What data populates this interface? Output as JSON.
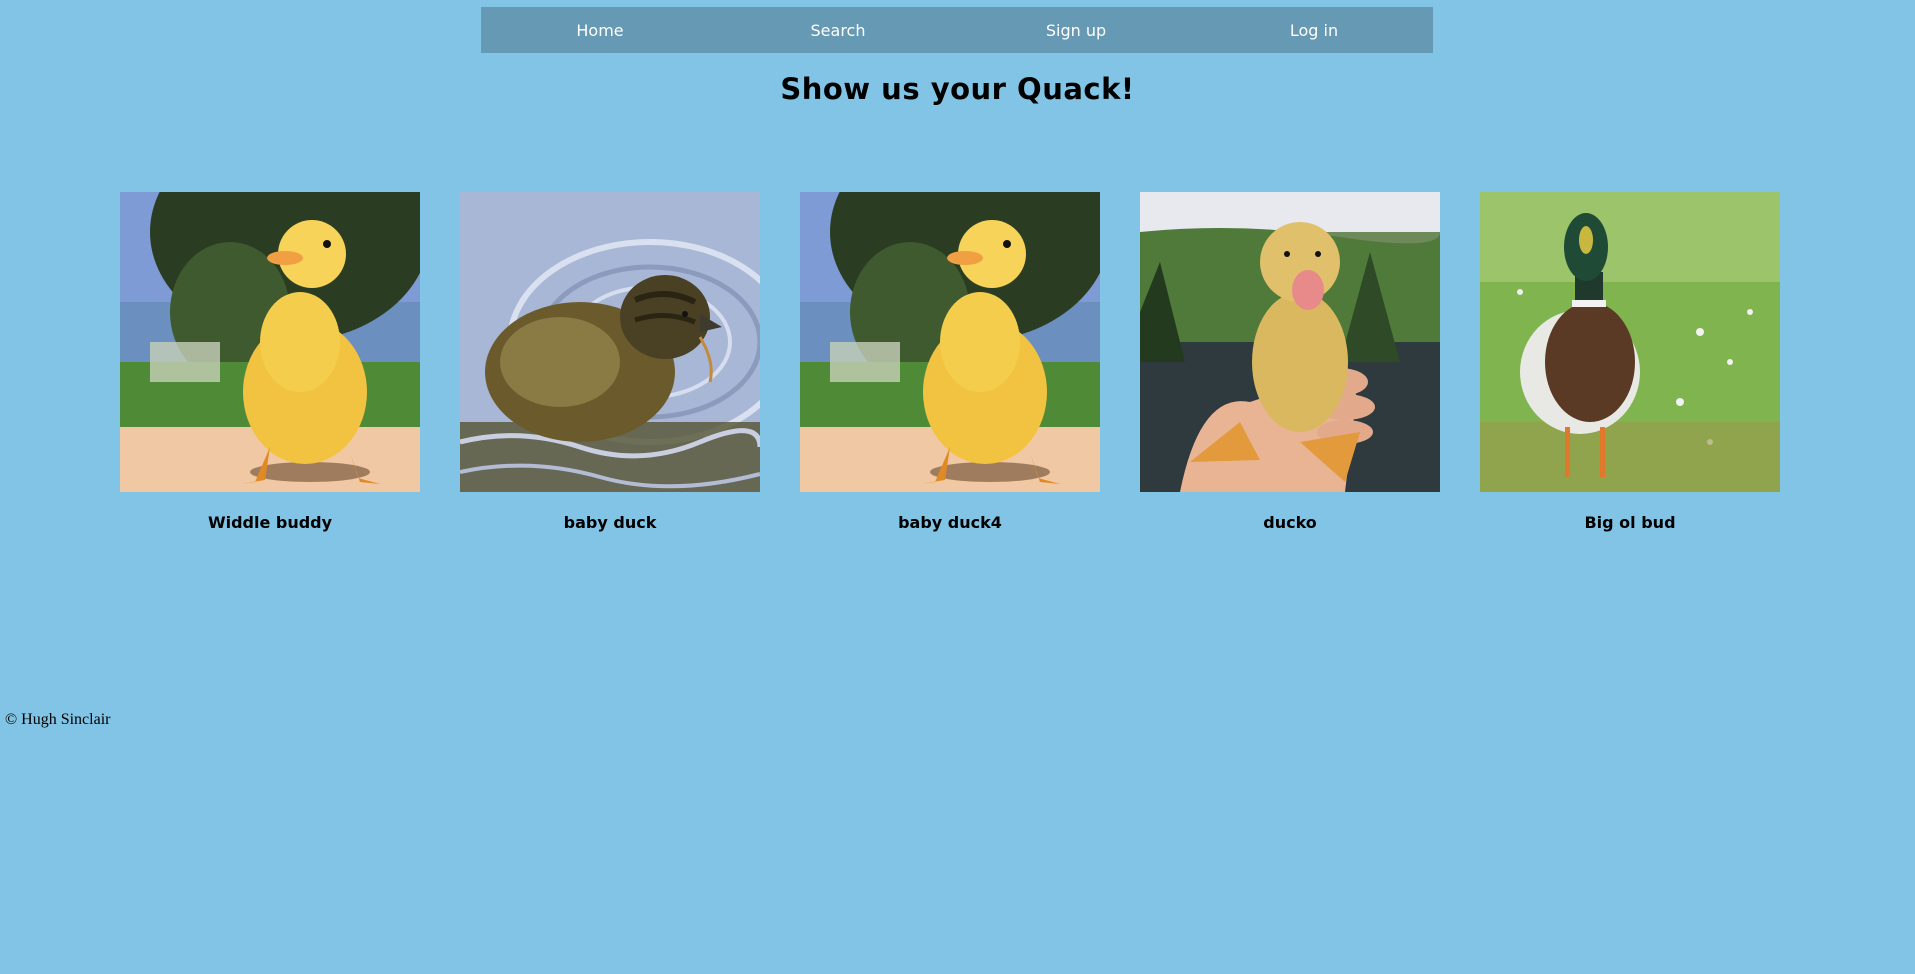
{
  "nav": {
    "items": [
      {
        "label": "Home"
      },
      {
        "label": "Search"
      },
      {
        "label": "Sign up"
      },
      {
        "label": "Log in"
      }
    ]
  },
  "page": {
    "title": "Show us your Quack!"
  },
  "gallery": {
    "items": [
      {
        "caption": "Widdle buddy",
        "image": "yellow-duckling-photo"
      },
      {
        "caption": "baby duck",
        "image": "duckling-in-water-photo"
      },
      {
        "caption": "baby duck4",
        "image": "yellow-duckling-photo"
      },
      {
        "caption": "ducko",
        "image": "duckling-in-hand-photo"
      },
      {
        "caption": "Big ol bud",
        "image": "mallard-duck-photo"
      }
    ]
  },
  "footer": {
    "text": "© Hugh Sinclair"
  }
}
